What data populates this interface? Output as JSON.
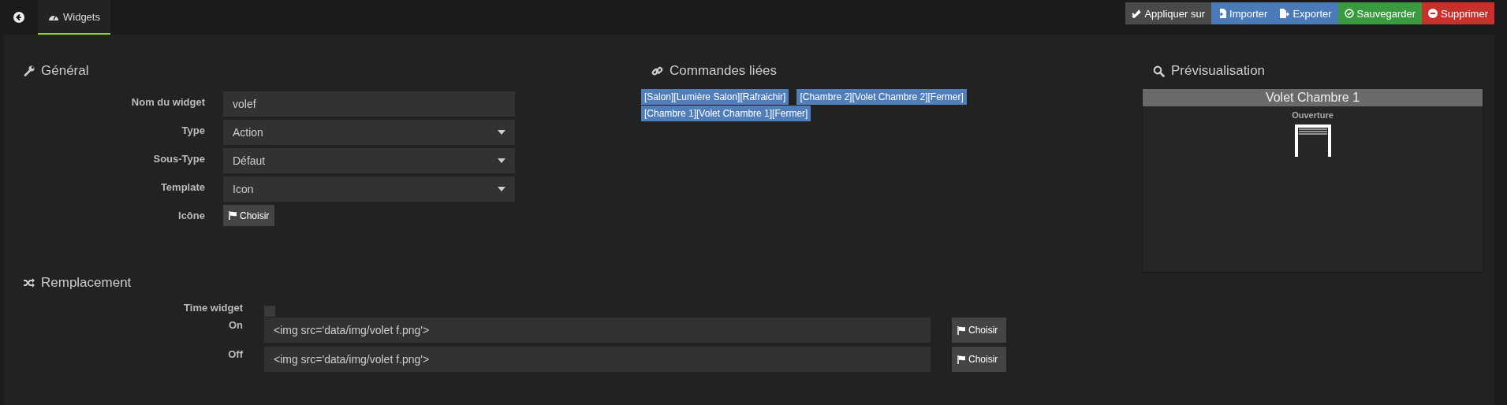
{
  "top_bar": {
    "tabs": [
      {
        "label": "Widgets",
        "selected": true
      }
    ],
    "actions": [
      {
        "label": "Appliquer sur",
        "kind": "apply"
      },
      {
        "label": "Importer",
        "kind": "import"
      },
      {
        "label": "Exporter",
        "kind": "export"
      },
      {
        "label": "Sauvegarder",
        "kind": "save"
      },
      {
        "label": "Supprimer",
        "kind": "delete"
      }
    ]
  },
  "general": {
    "title": "Général",
    "fields": [
      {
        "label": "Nom du widget",
        "kind": "text",
        "value": "volef"
      },
      {
        "label": "Type",
        "kind": "select",
        "value": "Action"
      },
      {
        "label": "Sous-Type",
        "kind": "select",
        "value": "Défaut"
      },
      {
        "label": "Template",
        "kind": "select",
        "value": "Icon"
      },
      {
        "label": "Icône",
        "kind": "button",
        "button": "Choisir"
      }
    ]
  },
  "linked_commands": {
    "title": "Commandes liées",
    "commands": [
      "[Salon][Lumière Salon][Rafraichir]",
      "[Chambre 2][Volet Chambre 2][Fermer]",
      "[Chambre 1][Volet Chambre 1][Fermer]"
    ]
  },
  "preview": {
    "title": "Prévisualisation",
    "widget_title": "Volet Chambre 1",
    "command_name": "Ouverture"
  },
  "replacement": {
    "title": "Remplacement",
    "time_widget": {
      "label": "Time widget",
      "checked": false
    },
    "rows": [
      {
        "label": "On",
        "value": "<img src='data/img/volet f.png'>",
        "button": "Choisir"
      },
      {
        "label": "Off",
        "value": "<img src='data/img/volet f.png'>",
        "button": "Choisir"
      }
    ]
  }
}
